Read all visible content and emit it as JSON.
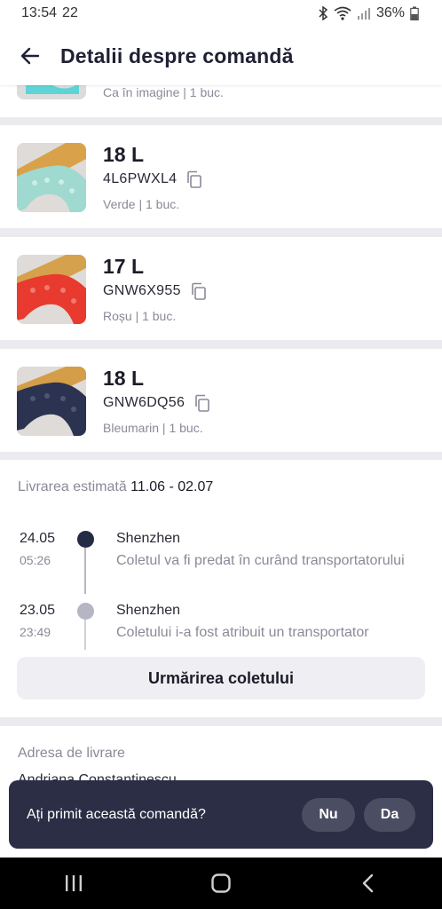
{
  "status_bar": {
    "time": "13:54",
    "extra": "22",
    "battery": "36%"
  },
  "header": {
    "title": "Detalii despre comandă"
  },
  "partial_item": {
    "variant": "Ca în imagine | 1 buc.",
    "thumb_color": "#5fd3d6"
  },
  "items": [
    {
      "price": "18 L",
      "code": "4L6PWXL4",
      "variant": "Verde | 1 buc.",
      "lace_color": "#9fd9d0",
      "bg_color": "#d9a24a"
    },
    {
      "price": "17 L",
      "code": "GNW6X955",
      "variant": "Roșu | 1 buc.",
      "lace_color": "#e83a2e",
      "bg_color": "#d6a14c"
    },
    {
      "price": "18 L",
      "code": "GNW6DQ56",
      "variant": "Bleumarin | 1 buc.",
      "lace_color": "#2b3350",
      "bg_color": "#d49d47"
    }
  ],
  "delivery": {
    "label": "Livrarea estimată",
    "dates": "11.06 - 02.07",
    "events": [
      {
        "date": "24.05",
        "time": "05:26",
        "city": "Shenzhen",
        "desc": "Coletul va fi predat în curând transportatorului"
      },
      {
        "date": "23.05",
        "time": "23:49",
        "city": "Shenzhen",
        "desc": "Coletului i-a fost atribuit un transportator"
      }
    ],
    "track_button": "Urmărirea coletului"
  },
  "address": {
    "label": "Adresa de livrare",
    "name": "Andriana Constantinescu"
  },
  "toast": {
    "question": "Ați primit această comandă?",
    "no": "Nu",
    "yes": "Da"
  },
  "colors": {
    "dark_dot": "#252a45",
    "light_dot": "#b5b5c4",
    "toast_bg": "#2b2e45"
  }
}
